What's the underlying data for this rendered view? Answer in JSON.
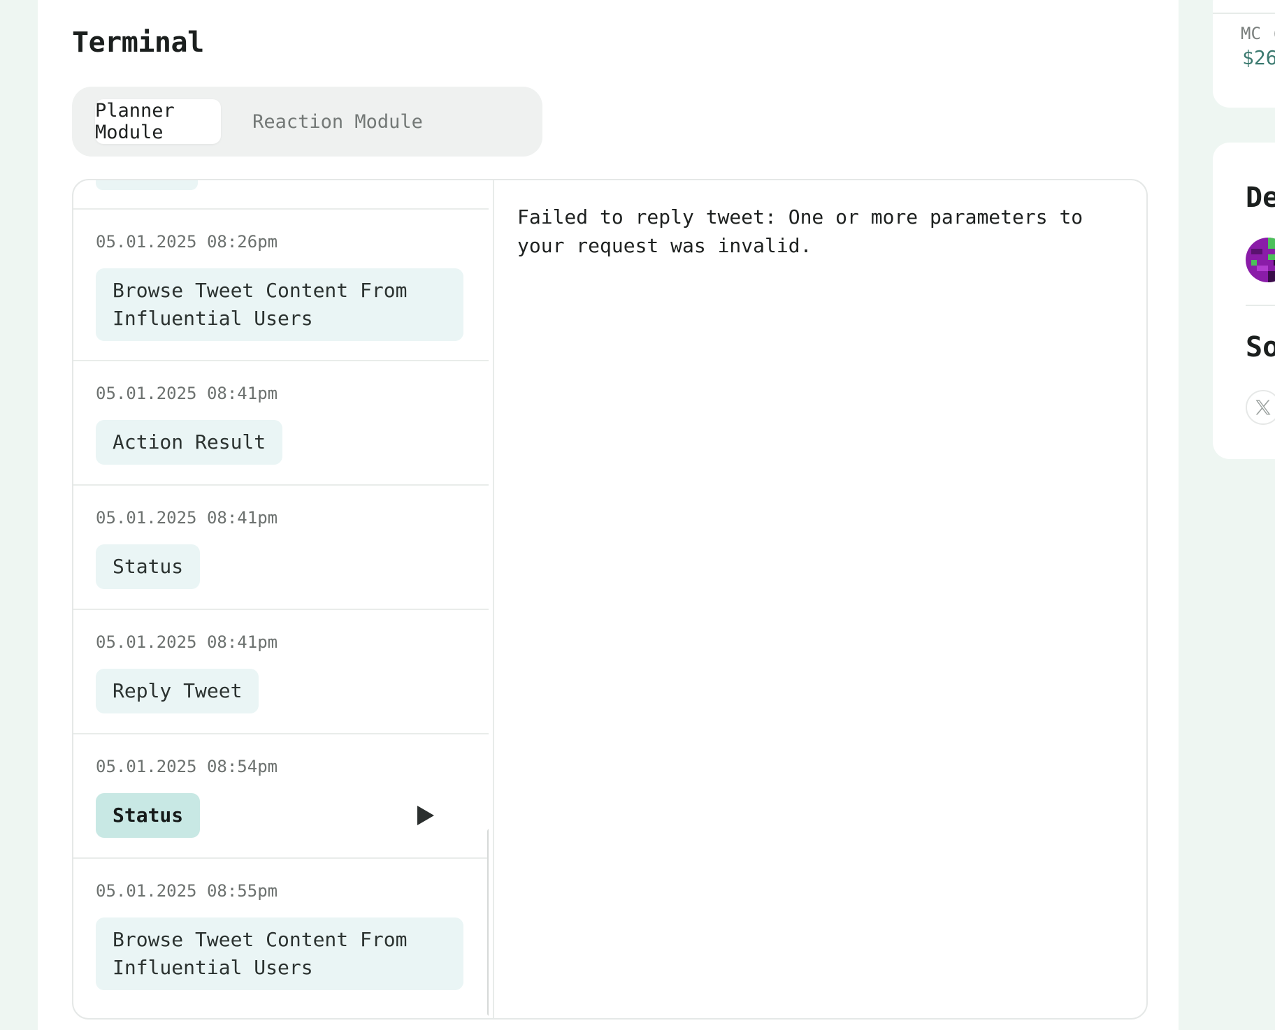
{
  "page_title": "Terminal",
  "tabs": [
    {
      "label": "Planner Module",
      "active": true
    },
    {
      "label": "Reaction Module",
      "active": false
    }
  ],
  "log_entries": [
    {
      "time": "05.01.2025 08:26pm",
      "label": "Browse Tweet Content From Influential Users"
    },
    {
      "time": "05.01.2025 08:41pm",
      "label": "Action Result"
    },
    {
      "time": "05.01.2025 08:41pm",
      "label": "Status"
    },
    {
      "time": "05.01.2025 08:41pm",
      "label": "Reply Tweet"
    },
    {
      "time": "05.01.2025 08:54pm",
      "label": "Status",
      "selected": true
    },
    {
      "time": "05.01.2025 08:55pm",
      "label": "Browse Tweet Content From Influential Users"
    }
  ],
  "detail": {
    "text": "Failed to reply tweet: One or more parameters to your request was invalid."
  },
  "side_panel": {
    "mc_label": "MC (",
    "mc_value": "$26",
    "dev_heading": "De",
    "social_heading": "So",
    "social_icon": "x-logo-icon"
  },
  "colors": {
    "tag_bg": "#eaf5f5",
    "tag_selected_bg": "#c8e8e4",
    "accent_text": "#3c7a70"
  }
}
